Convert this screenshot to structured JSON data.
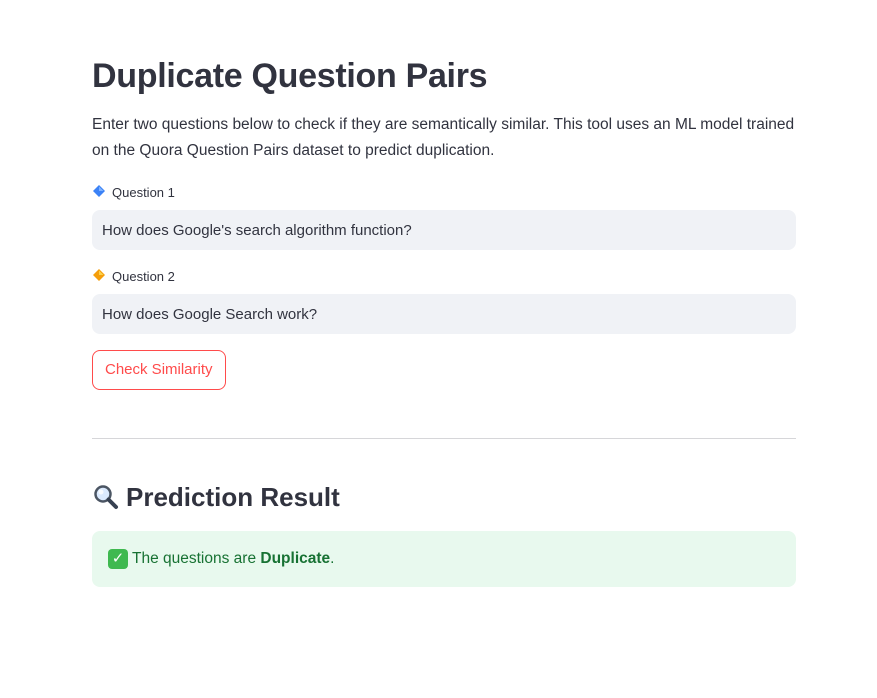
{
  "header": {
    "title": "Duplicate Question Pairs",
    "intro": "Enter two questions below to check if they are semantically similar. This tool uses an ML model trained on the Quora Question Pairs dataset to predict duplication."
  },
  "form": {
    "question1": {
      "label": "Question 1",
      "icon": "blue-diamond-icon",
      "value": "How does Google's search algorithm function?"
    },
    "question2": {
      "label": "Question 2",
      "icon": "orange-diamond-icon",
      "value": "How does Google Search work?"
    },
    "check_button_label": "Check Similarity"
  },
  "result": {
    "heading": "Prediction Result",
    "heading_icon": "magnifier-icon",
    "message_prefix": "The questions are ",
    "verdict": "Duplicate",
    "message_suffix": ".",
    "status_icon": "check-mark-icon"
  },
  "colors": {
    "accent": "#ff4b4b",
    "success_bg": "#e8f9ee",
    "success_text": "#177233",
    "input_bg": "#f0f2f6",
    "text": "#31333f"
  }
}
